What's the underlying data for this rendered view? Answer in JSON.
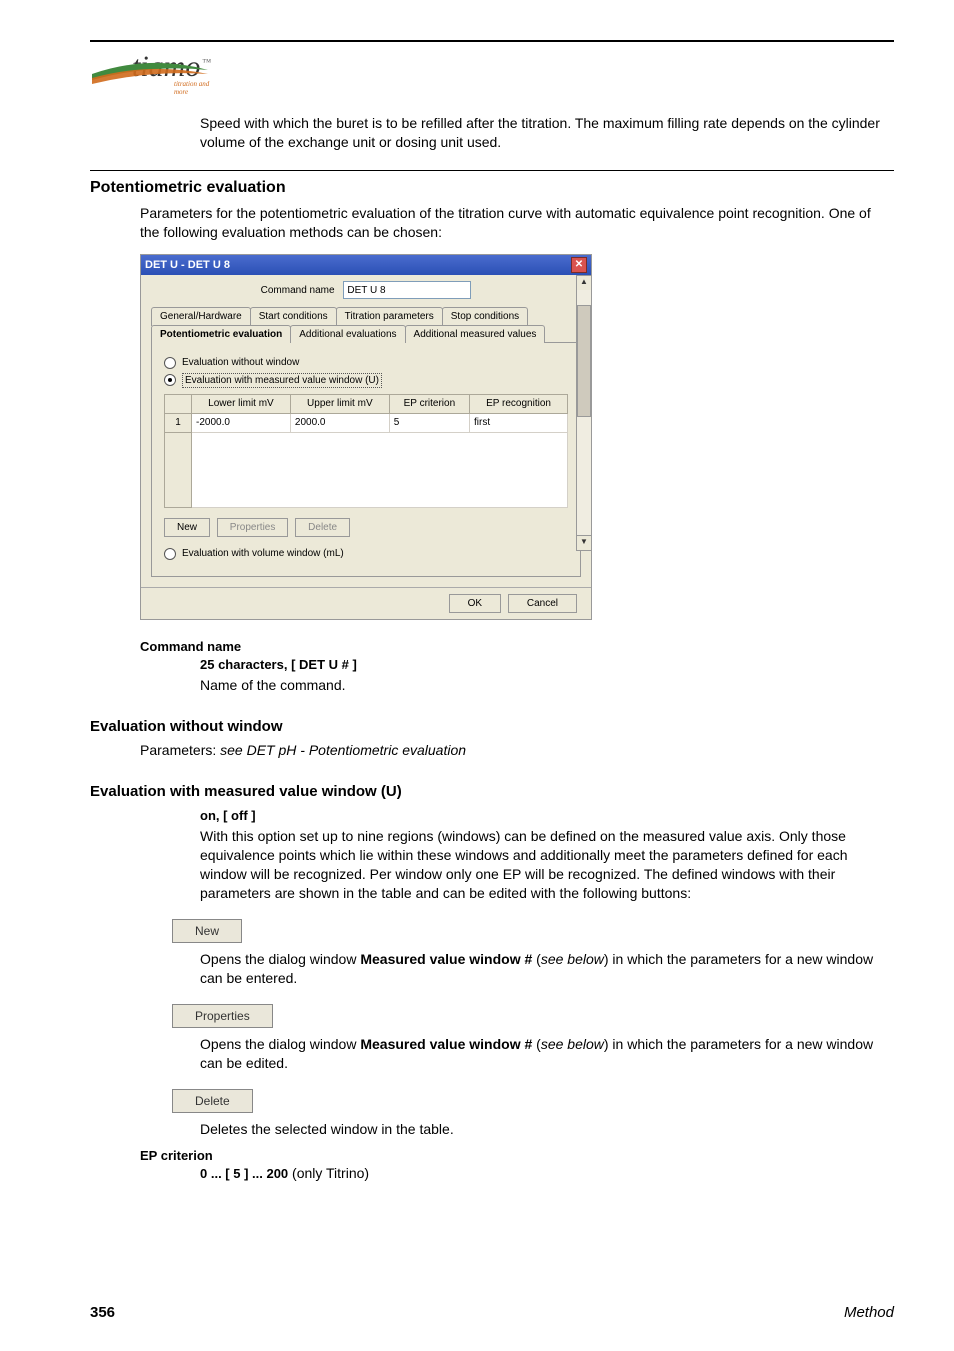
{
  "logo": {
    "text": "tiamo",
    "tm": "™",
    "sub": "titration and more"
  },
  "intro_para": "Speed with which the buret is to be refilled after the titration. The maximum filling rate depends on the cylinder volume of the exchange unit or dosing unit used.",
  "sec_potent": {
    "heading": "Potentiometric evaluation",
    "para": "Parameters for the potentiometric evaluation of the titration curve with automatic equivalence point recognition. One of the following evaluation methods can be chosen:"
  },
  "dialog": {
    "title": "DET U - DET U 8",
    "command_name_label": "Command name",
    "command_name_value": "DET U 8",
    "tabs_row1": [
      "General/Hardware",
      "Start conditions",
      "Titration parameters",
      "Stop conditions"
    ],
    "tabs_row2": [
      "Potentiometric evaluation",
      "Additional evaluations",
      "Additional measured values"
    ],
    "active_tab_index": 0,
    "radios": {
      "r1": "Evaluation without window",
      "r2": "Evaluation with measured value window (U)",
      "r3": "Evaluation with volume window (mL)"
    },
    "table": {
      "headers": [
        "",
        "Lower limit mV",
        "Upper limit mV",
        "EP criterion",
        "EP recognition"
      ],
      "row": [
        "1",
        "-2000.0",
        "2000.0",
        "5",
        "first"
      ]
    },
    "buttons": {
      "new": "New",
      "props": "Properties",
      "del": "Delete"
    },
    "ok": "OK",
    "cancel": "Cancel"
  },
  "cmd_name": {
    "label": "Command name",
    "spec": "25 characters, [ DET U # ]",
    "desc": "Name of the command."
  },
  "eval_without": {
    "heading": "Evaluation without window",
    "para_prefix": "Parameters: ",
    "para_italic": "see DET pH - Potentiometric evaluation"
  },
  "eval_with": {
    "heading": "Evaluation with measured value window (U)",
    "spec": "on, [ off ]",
    "para": "With this option set up to nine regions (windows) can be defined on the measured value axis. Only those equivalence points which lie within these windows and additionally meet the parameters defined for each window will be recognized. Per window only one EP will be recognized. The defined windows with their parameters are shown in the table and can be edited with the following buttons:"
  },
  "btn_new": {
    "label": "New",
    "desc_pre": "Opens the dialog window ",
    "desc_bold": "Measured value window #",
    "desc_mid": " (",
    "desc_italic": "see below",
    "desc_post": ") in which the parameters for a new window can be entered."
  },
  "btn_props": {
    "label": "Properties",
    "desc_pre": "Opens the dialog window ",
    "desc_bold": "Measured value window #",
    "desc_mid": " (",
    "desc_italic": "see below",
    "desc_post": ") in which the parameters for a new window can be edited."
  },
  "btn_del": {
    "label": "Delete",
    "desc": "Deletes the selected window in the table."
  },
  "ep_crit": {
    "label": "EP criterion",
    "spec": "0 ... [ 5 ] ... 200",
    "note": " (only Titrino)"
  },
  "footer": {
    "page": "356",
    "title": "Method"
  }
}
